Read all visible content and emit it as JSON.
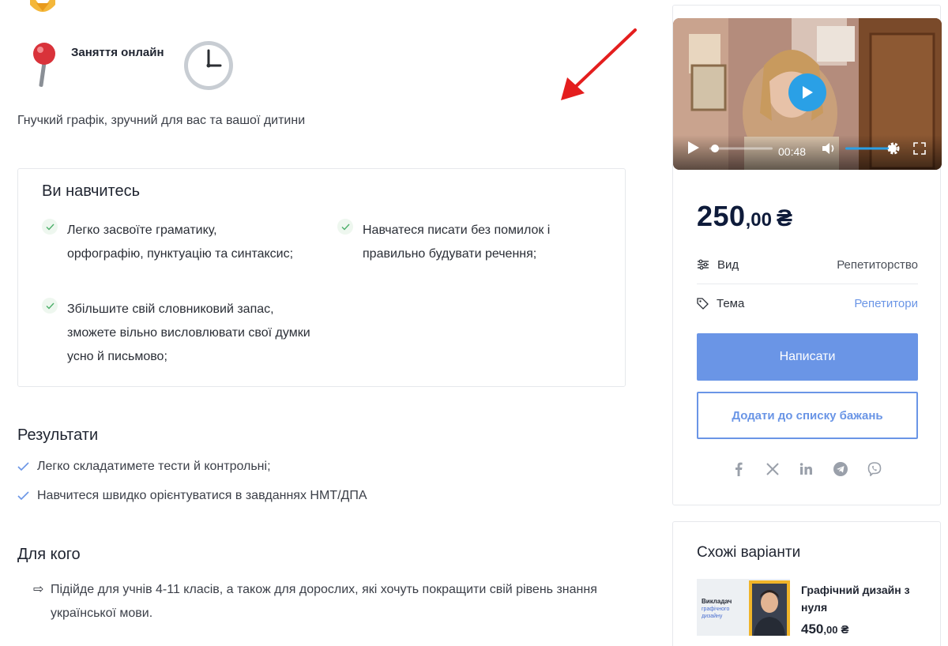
{
  "top": {
    "online_label": "Заняття онлайн",
    "flex_schedule": "Гнучкий графік, зручний для вас та вашої дитини"
  },
  "learn": {
    "title": "Ви навчитесь",
    "items": [
      "Легко засвоїте граматику, орфографію, пунктуацію та синтаксис;",
      "Навчатеся писати без помилок і правильно будувати речення;",
      "Збільшите свій словниковий запас, зможете вільно висловлювати свої думки усно й письмово;"
    ]
  },
  "results": {
    "title": "Результати",
    "items": [
      "Легко складатимете тести й контрольні;",
      "Навчитеся швидко орієнтуватися в завданнях НМТ/ДПА"
    ]
  },
  "for_whom": {
    "title": "Для кого",
    "arrow": "⇨",
    "text": "Підійде для учнів 4-11 класів, а також для дорослих, які хочуть покращити свій рівень знання української мови."
  },
  "video": {
    "time": "00:48"
  },
  "price": {
    "main": "250",
    "cents": ",00",
    "currency": "₴"
  },
  "meta": {
    "type_label": "Вид",
    "type_value": "Репетиторство",
    "topic_label": "Тема",
    "topic_value": "Репетитори"
  },
  "buttons": {
    "write": "Написати",
    "wishlist": "Додати до списку бажань"
  },
  "socials": [
    "facebook-icon",
    "x-icon",
    "linkedin-icon",
    "telegram-icon",
    "viber-icon"
  ],
  "similar": {
    "title": "Схожі варіанти",
    "thumb_line1": "Викладач",
    "thumb_line2": "графічного дизайну",
    "item_name": "Графічний дизайн з нуля",
    "item_price_main": "450",
    "item_price_cents": ",00",
    "item_currency": "₴"
  },
  "colors": {
    "accent": "#6a95e6",
    "play": "#2aa0e6",
    "price": "#0e1b3a",
    "annotation_arrow": "#e41e1e"
  }
}
